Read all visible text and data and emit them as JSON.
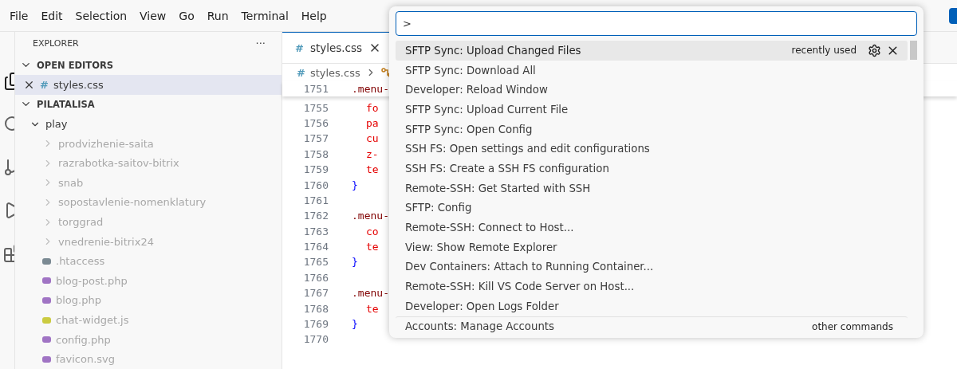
{
  "menu": [
    "File",
    "Edit",
    "Selection",
    "View",
    "Go",
    "Run",
    "Terminal",
    "Help"
  ],
  "sidebar": {
    "title": "EXPLORER",
    "more": "···",
    "sections": [
      {
        "label": "OPEN EDITORS",
        "expanded": true,
        "items": [
          {
            "name": "styles.css",
            "icon": "#",
            "selected": true
          }
        ]
      },
      {
        "label": "PILATALISA",
        "expanded": true,
        "items": [
          {
            "name": "play",
            "kind": "folder",
            "expanded": true,
            "children": [
              {
                "name": "prodvizhenie-saita",
                "kind": "folder",
                "expanded": false
              },
              {
                "name": "razrabotka-saitov-bitrix",
                "kind": "folder",
                "expanded": false
              },
              {
                "name": "snab",
                "kind": "folder",
                "expanded": false
              },
              {
                "name": "sopostavlenie-nomenklatury",
                "kind": "folder",
                "expanded": false
              },
              {
                "name": "torggrad",
                "kind": "folder",
                "expanded": false
              },
              {
                "name": "vnedrenie-bitrix24",
                "kind": "folder",
                "expanded": false
              },
              {
                "name": ".htaccess",
                "kind": "file",
                "color": "#7b8a93"
              },
              {
                "name": "blog-post.php",
                "kind": "file",
                "color": "#a074c4"
              },
              {
                "name": "blog.php",
                "kind": "file",
                "color": "#a074c4"
              },
              {
                "name": "chat-widget.js",
                "kind": "file",
                "color": "#cbcb41"
              },
              {
                "name": "config.php",
                "kind": "file",
                "color": "#a074c4"
              },
              {
                "name": "favicon.svg",
                "kind": "file",
                "color": "#a074c4"
              }
            ]
          }
        ]
      }
    ]
  },
  "editor": {
    "tab": {
      "icon": "#",
      "title": "styles.css",
      "selected": true
    },
    "breadcrumb": [
      {
        "icon": "#",
        "text": "styles.css"
      }
    ],
    "lines": [
      {
        "number": "1751",
        "kind": "selector",
        "text": ".menu-",
        "sticky": true
      },
      {
        "number": "1755",
        "kind": "property",
        "text": "fo"
      },
      {
        "number": "1756",
        "kind": "property",
        "text": "pa"
      },
      {
        "number": "1757",
        "kind": "property",
        "text": "cu"
      },
      {
        "number": "1758",
        "kind": "property",
        "text": "z-"
      },
      {
        "number": "1759",
        "kind": "property",
        "text": "te"
      },
      {
        "number": "1760",
        "kind": "brace",
        "text": "}"
      },
      {
        "number": "1761",
        "kind": "blank"
      },
      {
        "number": "1762",
        "kind": "selector",
        "text": ".menu-"
      },
      {
        "number": "1763",
        "kind": "property",
        "text": "co"
      },
      {
        "number": "1764",
        "kind": "property",
        "text": "te"
      },
      {
        "number": "1765",
        "kind": "brace",
        "text": "}"
      },
      {
        "number": "1766",
        "kind": "blank"
      },
      {
        "number": "1767",
        "kind": "selector",
        "text": ".menu-"
      },
      {
        "number": "1768",
        "kind": "property",
        "text": "te"
      },
      {
        "number": "1769",
        "kind": "brace",
        "text": "}"
      },
      {
        "number": "1770",
        "kind": "blank"
      }
    ]
  },
  "command_palette": {
    "value": ">",
    "items": [
      {
        "label": "SFTP Sync: Upload Changed Files",
        "selected": true,
        "note": "recently used"
      },
      {
        "label": "SFTP Sync: Download All",
        "selected": false
      },
      {
        "label": "Developer: Reload Window",
        "selected": false
      },
      {
        "label": "SFTP Sync: Upload Current File",
        "selected": false
      },
      {
        "label": "SFTP Sync: Open Config",
        "selected": false
      },
      {
        "label": "SSH FS: Open settings and edit configurations",
        "selected": false
      },
      {
        "label": "SSH FS: Create a SSH FS configuration",
        "selected": false
      },
      {
        "label": "Remote-SSH: Get Started with SSH",
        "selected": false
      },
      {
        "label": "SFTP: Config",
        "selected": false
      },
      {
        "label": "Remote-SSH: Connect to Host...",
        "selected": false
      },
      {
        "label": "View: Show Remote Explorer",
        "selected": false
      },
      {
        "label": "Dev Containers: Attach to Running Container...",
        "selected": false
      },
      {
        "label": "Remote-SSH: Kill VS Code Server on Host...",
        "selected": false
      },
      {
        "label": "Developer: Open Logs Folder",
        "selected": false
      },
      {
        "label": "Accounts: Manage Accounts",
        "selected": false,
        "note": "other commands",
        "separator": true
      }
    ]
  }
}
